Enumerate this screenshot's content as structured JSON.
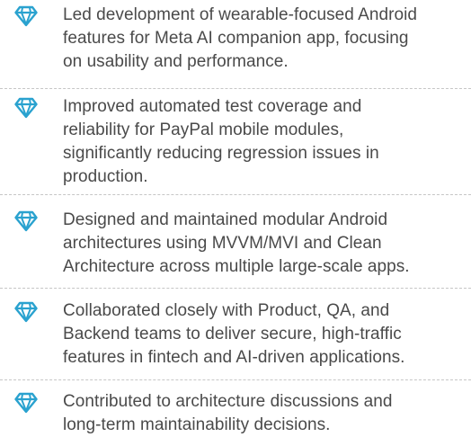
{
  "accent_color": "#2aa2cf",
  "icon": "diamond-icon",
  "items": [
    {
      "line1": "Led development of wearable-focused Android",
      "line2": "features for Meta AI companion app, focusing",
      "line3": "on usability and performance.",
      "line4": ""
    },
    {
      "line1": "Improved automated test coverage and",
      "line2": "reliability for PayPal mobile modules,",
      "line3": "significantly reducing regression issues in",
      "line4": "production."
    },
    {
      "line1": "Designed and maintained modular Android",
      "line2": "architectures using MVVM/MVI and Clean",
      "line3": "Architecture across multiple large-scale apps.",
      "line4": ""
    },
    {
      "line1": "Collaborated closely with Product, QA, and",
      "line2": "Backend teams to deliver secure, high-traffic",
      "line3": "features in fintech and AI-driven applications.",
      "line4": ""
    },
    {
      "line1": "Contributed to architecture discussions and",
      "line2": "long-term maintainability decisions.",
      "line3": "",
      "line4": ""
    }
  ]
}
